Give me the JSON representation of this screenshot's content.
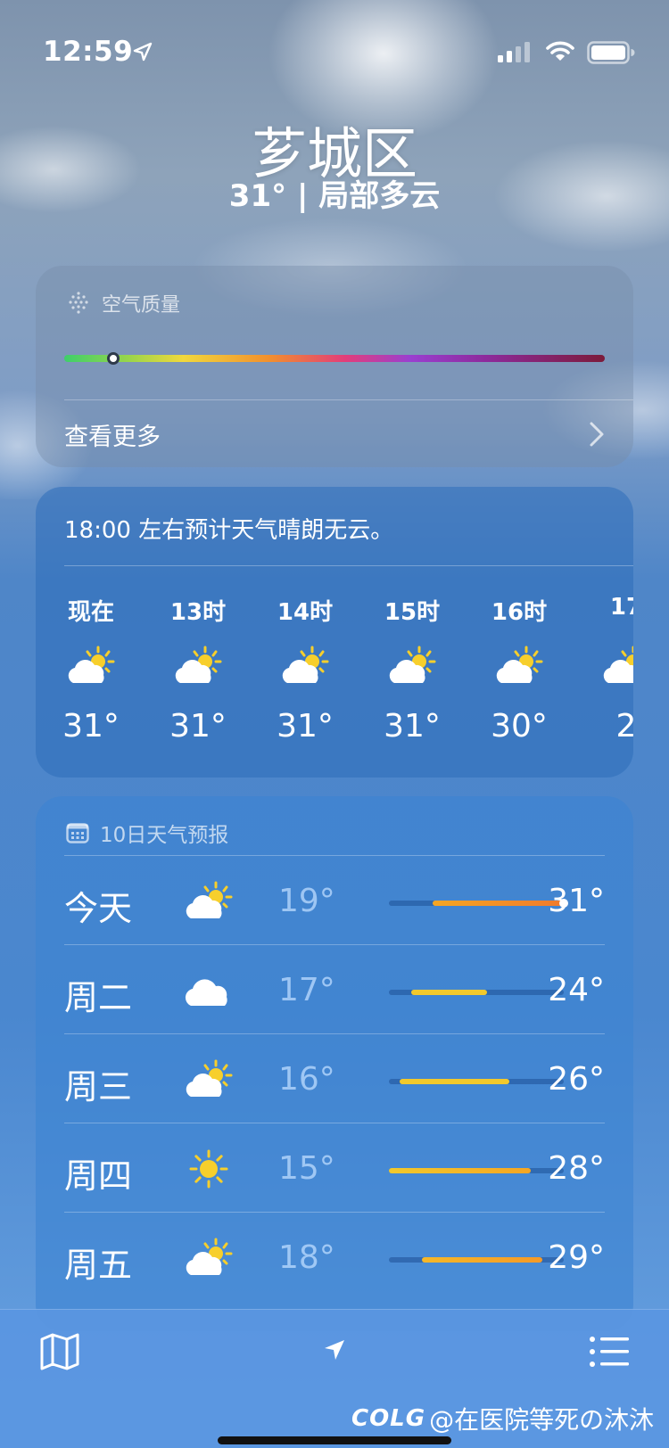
{
  "status_bar": {
    "time": "12:59"
  },
  "location": {
    "city": "芗城区",
    "condition_line": "31° | 局部多云"
  },
  "air_quality": {
    "title": "空气质量",
    "level_fraction": 0.09,
    "see_more": "查看更多"
  },
  "hourly": {
    "summary": "18:00 左右预计天气晴朗无云。",
    "items": [
      {
        "label": "现在",
        "icon": "partly-cloudy-icon",
        "temp": "31°"
      },
      {
        "label": "13时",
        "icon": "partly-cloudy-icon",
        "temp": "31°"
      },
      {
        "label": "14时",
        "icon": "partly-cloudy-icon",
        "temp": "31°"
      },
      {
        "label": "15时",
        "icon": "partly-cloudy-icon",
        "temp": "31°"
      },
      {
        "label": "16时",
        "icon": "partly-cloudy-icon",
        "temp": "30°"
      },
      {
        "label": "17",
        "icon": "partly-cloudy-icon",
        "temp": "2"
      }
    ]
  },
  "daily": {
    "title": "10日天气预报",
    "range_min": 15,
    "range_max": 31,
    "rows": [
      {
        "day": "今天",
        "icon": "partly-cloudy-icon",
        "low": "19°",
        "high": "31°",
        "low_v": 19,
        "high_v": 31,
        "now_v": 31,
        "color_from": "#f5a623",
        "color_to": "#f07a2c"
      },
      {
        "day": "周二",
        "icon": "cloud-icon",
        "low": "17°",
        "high": "24°",
        "low_v": 17,
        "high_v": 24,
        "color_from": "#f2c92c",
        "color_to": "#f2c92c"
      },
      {
        "day": "周三",
        "icon": "partly-cloudy-icon",
        "low": "16°",
        "high": "26°",
        "low_v": 16,
        "high_v": 26,
        "color_from": "#f2c92c",
        "color_to": "#f2c92c"
      },
      {
        "day": "周四",
        "icon": "sun-icon",
        "low": "15°",
        "high": "28°",
        "low_v": 15,
        "high_v": 28,
        "color_from": "#f2c92c",
        "color_to": "#f5a623"
      },
      {
        "day": "周五",
        "icon": "partly-cloudy-icon",
        "low": "18°",
        "high": "29°",
        "low_v": 18,
        "high_v": 29,
        "color_from": "#f5b829",
        "color_to": "#f59a27"
      }
    ]
  },
  "toolbar": {
    "map_icon": "map-icon",
    "location_icon": "location-arrow-icon",
    "list_icon": "list-icon"
  },
  "watermark": {
    "logo": "COLG",
    "text": "@在医院等死の沐沐"
  }
}
